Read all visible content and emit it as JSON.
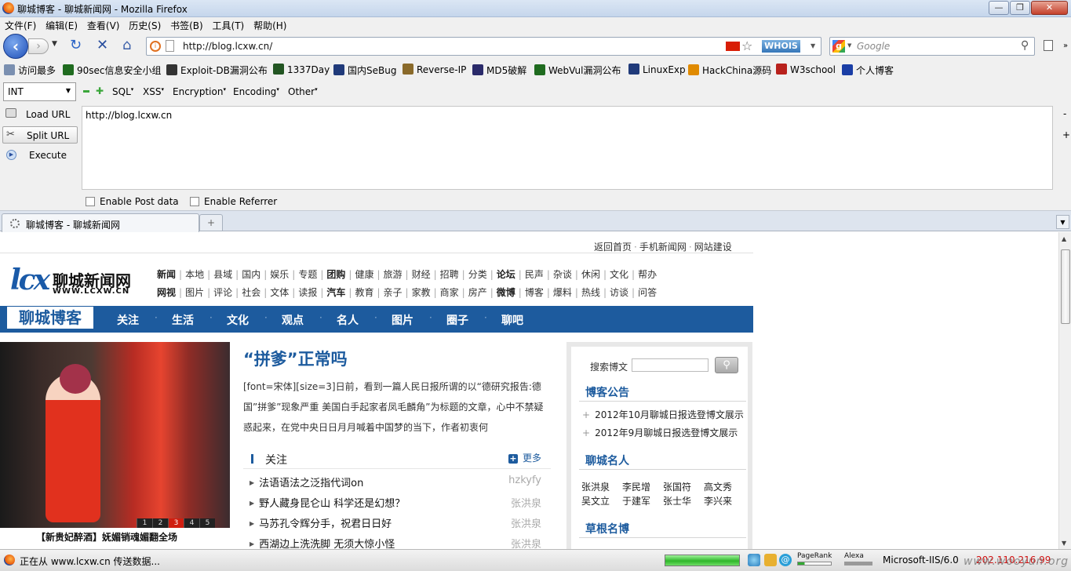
{
  "window": {
    "title": "聊城博客 - 聊城新闻网 - Mozilla Firefox",
    "min": "—",
    "max": "❐",
    "close": "✕"
  },
  "menu": [
    "文件(F)",
    "编辑(E)",
    "查看(V)",
    "历史(S)",
    "书签(B)",
    "工具(T)",
    "帮助(H)"
  ],
  "nav": {
    "url": "http://blog.lcxw.cn/",
    "whois": "WHOIS",
    "search_placeholder": "Google"
  },
  "bookmarks": [
    {
      "label": "访问最多",
      "icon": "gear-icon",
      "color": "#7a8fb0"
    },
    {
      "label": "90sec信息安全小组",
      "icon": "bug-icon",
      "color": "#1f6b1f"
    },
    {
      "label": "Exploit-DB漏洞公布",
      "icon": "exploit-icon",
      "color": "#333333"
    },
    {
      "label": "1337Day",
      "icon": "skull-icon",
      "color": "#225522"
    },
    {
      "label": "国内SeBug",
      "icon": "s-icon",
      "color": "#203a7a"
    },
    {
      "label": "Reverse-IP",
      "icon": "tools-icon",
      "color": "#8a6a2a"
    },
    {
      "label": "MD5破解",
      "icon": "grid-icon",
      "color": "#2a2a6a"
    },
    {
      "label": "WebVul漏洞公布",
      "icon": "bug-icon",
      "color": "#1f6b1f"
    },
    {
      "label": "LinuxExp",
      "icon": "s-icon",
      "color": "#203a7a"
    },
    {
      "label": "HackChina源码",
      "icon": "hc-icon",
      "color": "#e08a00"
    },
    {
      "label": "W3school",
      "icon": "w3-icon",
      "color": "#b8211c"
    },
    {
      "label": "个人博客",
      "icon": "paw-icon",
      "color": "#1a3ea6"
    }
  ],
  "hackbar": {
    "type_value": "INT",
    "menus": [
      "SQL",
      "XSS",
      "Encryption",
      "Encoding",
      "Other"
    ],
    "load_url": "Load URL",
    "split_url": "Split URL",
    "execute": "Execute",
    "textarea_value": "http://blog.lcxw.cn",
    "post_label": "Enable Post data",
    "referrer_label": "Enable Referrer",
    "side_minus": "-",
    "side_plus": "+"
  },
  "tab": {
    "title": "聊城博客 - 聊城新闻网",
    "new_tab": "+"
  },
  "page": {
    "toplinks": [
      "返回首页",
      "手机新闻网",
      "网站建设"
    ],
    "logo_cn": "聊城新闻网",
    "logo_en": "WWW.LCXW.CN",
    "channels_row1": [
      "新闻",
      "本地",
      "县域",
      "国内",
      "娱乐",
      "专题",
      "团购",
      "健康",
      "旅游",
      "财经",
      "招聘",
      "分类",
      "论坛",
      "民声",
      "杂谈",
      "休闲",
      "文化",
      "帮办"
    ],
    "channels_row2": [
      "网视",
      "图片",
      "评论",
      "社会",
      "文体",
      "读报",
      "汽车",
      "教育",
      "亲子",
      "家教",
      "商家",
      "房产",
      "微博",
      "博客",
      "爆料",
      "热线",
      "访谈",
      "问答"
    ],
    "blog_title": "聊城博客",
    "blog_nav": [
      "关注",
      "生活",
      "文化",
      "观点",
      "名人",
      "图片",
      "圈子",
      "聊吧"
    ],
    "photo_pages": [
      "1",
      "2",
      "3",
      "4",
      "5"
    ],
    "photo_active_page": 3,
    "photo_caption": "【新贵妃醉酒】妩媚销魂媚翻全场",
    "article_title": "“拼爹”正常吗",
    "article_body": "[font=宋体][size=3]日前，看到一篇人民日报所谓的以“德研究报告:德国”拼爹”现象严重 美国白手起家者凤毛麟角”为标题的文章，心中不禁疑惑起来，在党中央日日月月喊着中国梦的当下，作者初衷何",
    "follow_label": "关注",
    "more_label": "更多",
    "follow_items": [
      {
        "title": "法语语法之泛指代词on",
        "author": "hzkyfy"
      },
      {
        "title": "野人藏身昆仑山 科学还是幻想？",
        "author": "张洪泉"
      },
      {
        "title": "马苏孔令辉分手，祝君日日好",
        "author": "张洪泉"
      },
      {
        "title": "西湖边上洗洗脚 无须大惊小怪",
        "author": "张洪泉"
      }
    ],
    "search_label": "搜索博文",
    "notice_head": "博客公告",
    "notices": [
      "2012年10月聊城日报选登博文展示",
      "2012年9月聊城日报选登博文展示"
    ],
    "famous_head": "聊城名人",
    "famous": [
      "张洪泉",
      "李民增",
      "张国符",
      "高文秀",
      "吴文立",
      "于建军",
      "张士华",
      "李兴来"
    ],
    "grass_head": "草根名博"
  },
  "status": {
    "text": "正在从 www.lcxw.cn 传送数据...",
    "progress": 1.0,
    "pagerank_label": "PageRank",
    "alexa_label": "Alexa",
    "server": "Microsoft-IIS/6.0",
    "ip": "202.110.216.99"
  },
  "watermark": "www.wooyun.org"
}
